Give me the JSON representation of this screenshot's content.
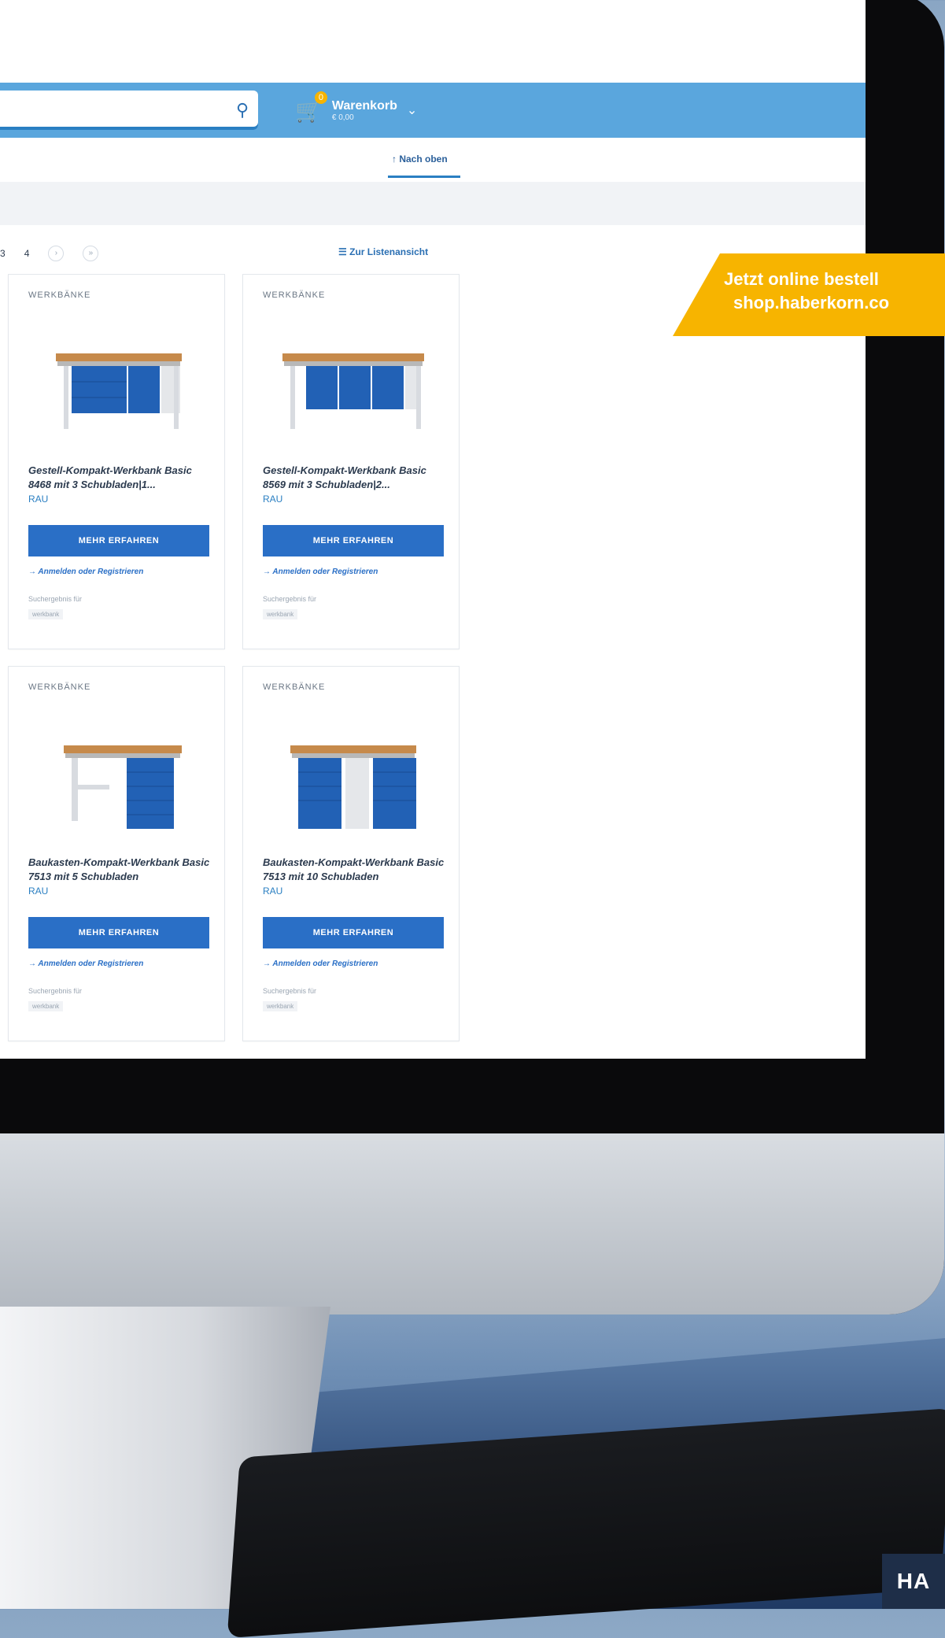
{
  "search": {
    "icon": "search-icon"
  },
  "cart": {
    "label": "Warenkorb",
    "amount": "€ 0,00",
    "badge": "0"
  },
  "nav": {
    "back_to_top": "Nach oben"
  },
  "pager": {
    "pages": [
      "3",
      "4"
    ],
    "next_symbol": "›",
    "last_symbol": "»",
    "list_view_label": "Zur Listenansicht"
  },
  "banner": {
    "line1": "Jetzt online bestell",
    "line2": "shop.haberkorn.co"
  },
  "brand_corner": "HA",
  "products": [
    {
      "category": "WERKBÄNKE",
      "title": "Gestell-Kompakt-Werkbank Basic 8468 mit 3 Schubladen|1...",
      "brand": "RAU",
      "button": "MEHR ERFAHREN",
      "login": "→ Anmelden oder Registrieren",
      "search_result_label": "Suchergebnis für",
      "search_term": "werkbank"
    },
    {
      "category": "WERKBÄNKE",
      "title": "Gestell-Kompakt-Werkbank Basic 8569 mit 3 Schubladen|2...",
      "brand": "RAU",
      "button": "MEHR ERFAHREN",
      "login": "→ Anmelden oder Registrieren",
      "search_result_label": "Suchergebnis für",
      "search_term": "werkbank"
    },
    {
      "category": "WERKBÄNKE",
      "title": "Baukasten-Kompakt-Werkbank Basic 7513 mit 5 Schubladen",
      "brand": "RAU",
      "button": "MEHR ERFAHREN",
      "login": "→ Anmelden oder Registrieren",
      "search_result_label": "Suchergebnis für",
      "search_term": "werkbank"
    },
    {
      "category": "WERKBÄNKE",
      "title": "Baukasten-Kompakt-Werkbank Basic 7513 mit 10 Schubladen",
      "brand": "RAU",
      "button": "MEHR ERFAHREN",
      "login": "→ Anmelden oder Registrieren",
      "search_result_label": "Suchergebnis für",
      "search_term": "werkbank"
    }
  ]
}
